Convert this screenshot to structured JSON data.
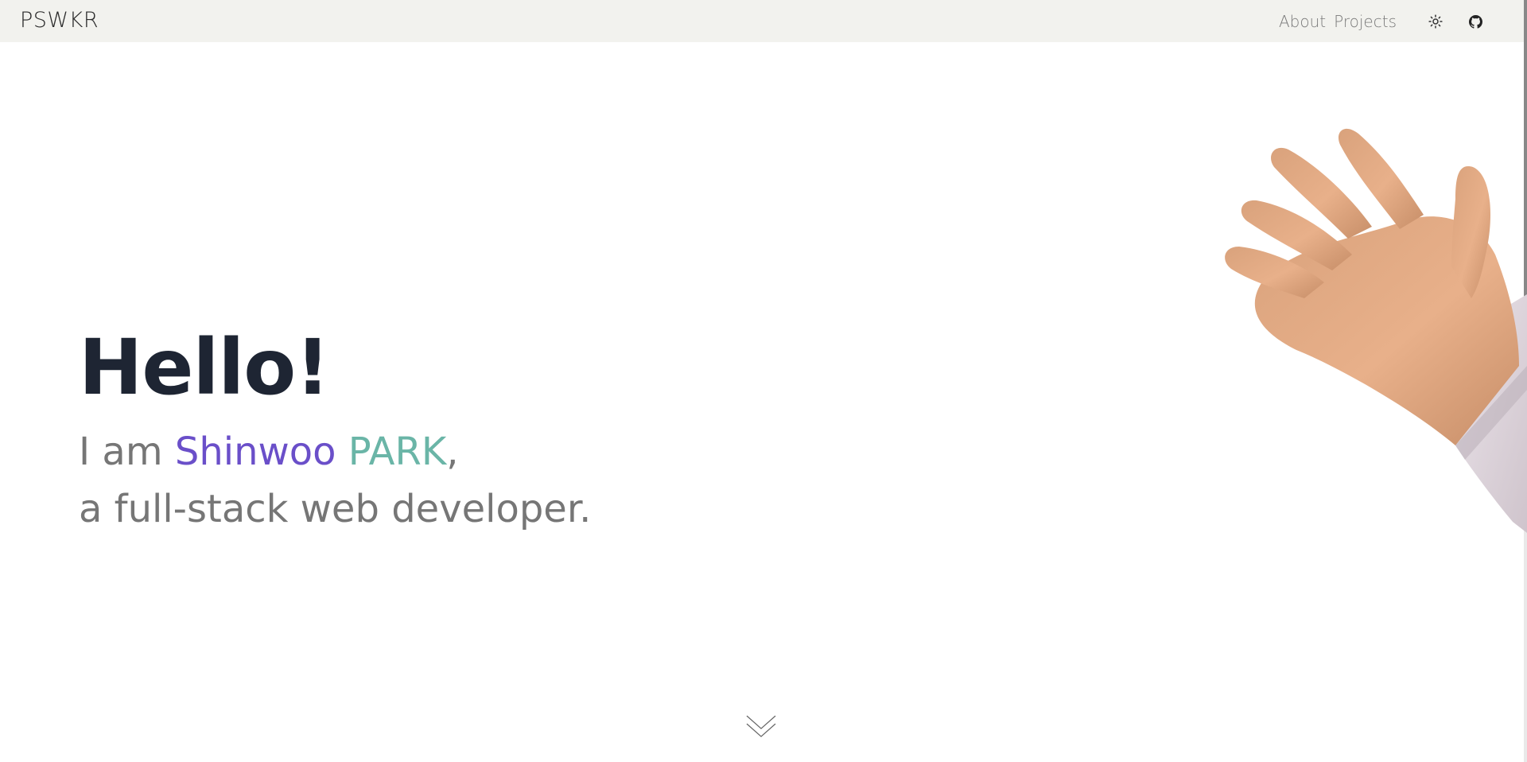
{
  "header": {
    "brand": "PSWKR",
    "nav": [
      {
        "label": "About"
      },
      {
        "label": "Projects"
      }
    ],
    "theme_icon": "sun-icon",
    "github_icon": "github-icon"
  },
  "hero": {
    "title": "Hello!",
    "intro_prefix": "I am ",
    "name_first": "Shinwoo",
    "name_space": " ",
    "name_last": "PARK",
    "intro_suffix": ",",
    "tagline": "a full-stack web developer.",
    "image": "waving-hand",
    "scroll_icon": "chevron-double-down-icon"
  },
  "colors": {
    "header_bg": "#f2f2ee",
    "title": "#1e2533",
    "body_text": "#767676",
    "name_first": "#6a4fc9",
    "name_last": "#6ab5a7"
  }
}
